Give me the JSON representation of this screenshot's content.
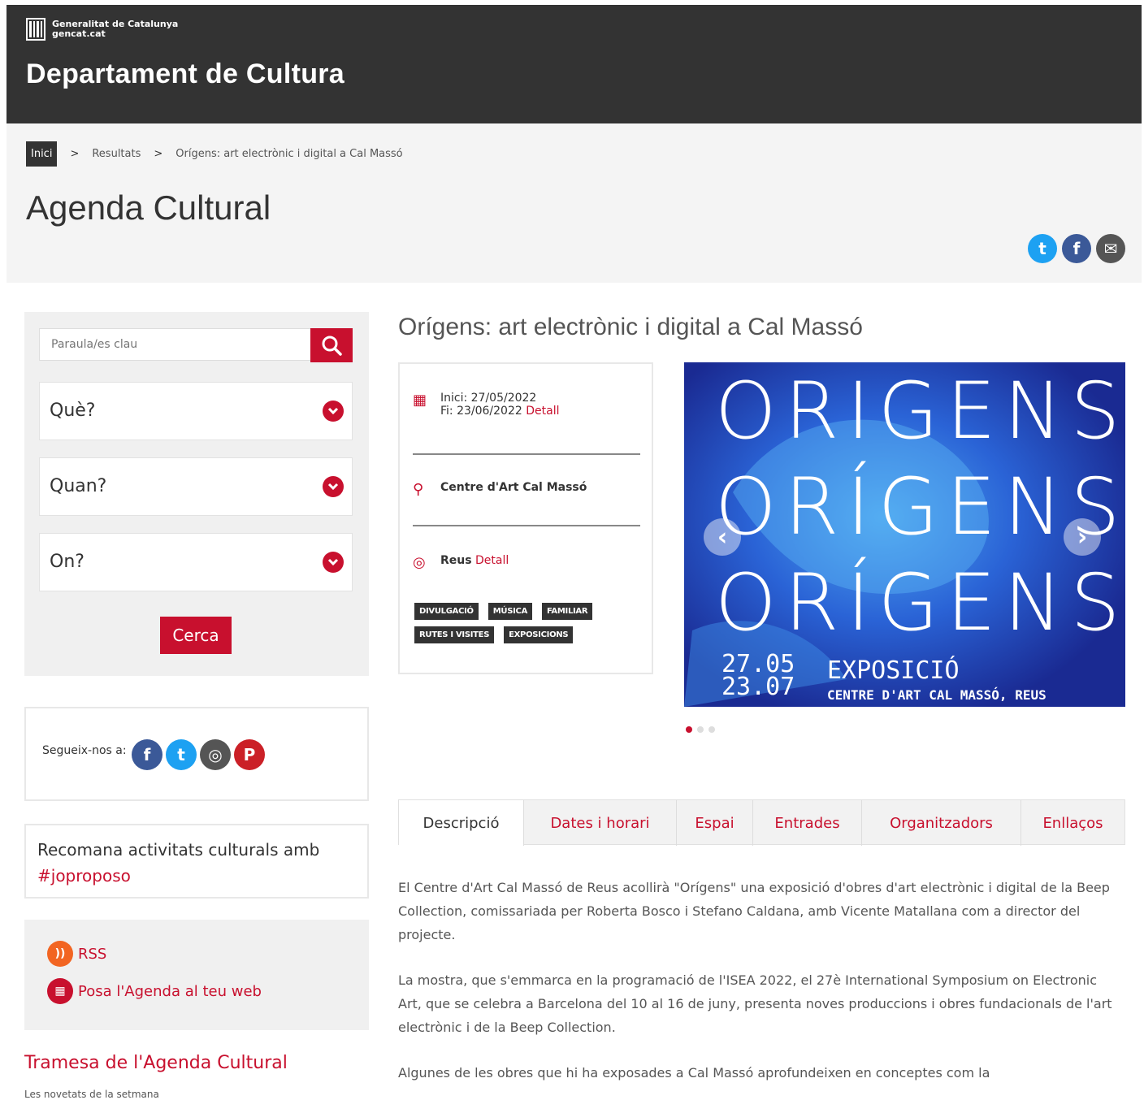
{
  "header": {
    "gov_line1": "Generalitat de Catalunya",
    "gov_line2": "gencat.cat",
    "department": "Departament de Cultura"
  },
  "breadcrumb": {
    "home": "Inici",
    "sep": ">",
    "results": "Resultats",
    "current": "Orígens: art electrònic i digital a Cal Massó"
  },
  "page_title": "Agenda Cultural",
  "share": [
    {
      "name": "twitter",
      "glyph": "t",
      "color": "#1da1f2"
    },
    {
      "name": "facebook",
      "glyph": "f",
      "color": "#3b5998"
    },
    {
      "name": "email",
      "glyph": "✉",
      "color": "#555555"
    }
  ],
  "search": {
    "placeholder": "Paraula/es clau",
    "filters": [
      "Què?",
      "Quan?",
      "On?"
    ],
    "button": "Cerca"
  },
  "follow": {
    "label": "Segueix-nos a:",
    "icons": [
      {
        "name": "facebook",
        "glyph": "f",
        "color": "#3b5998"
      },
      {
        "name": "twitter",
        "glyph": "t",
        "color": "#1da1f2"
      },
      {
        "name": "instagram",
        "glyph": "◎",
        "color": "#555555"
      },
      {
        "name": "pinterest",
        "glyph": "P",
        "color": "#cb2027"
      }
    ]
  },
  "recommend": {
    "text": "Recomana activitats culturals amb",
    "hashtag": "#joproposo"
  },
  "feeds": {
    "rss": "RSS",
    "embed": "Posa l'Agenda al teu web"
  },
  "newsletter": {
    "title": "Tramesa de l'Agenda Cultural",
    "subtitle": "Les novetats de la setmana"
  },
  "event": {
    "title": "Orígens: art electrònic i digital a Cal Massó",
    "start": "Inici: 27/05/2022",
    "end": "Fi: 23/06/2022",
    "detail": "Detall",
    "venue": "Centre d'Art Cal Massó",
    "city": "Reus",
    "tags": [
      "DIVULGACIÓ",
      "MÚSICA",
      "FAMILIAR",
      "RUTES I VISITES",
      "EXPOSICIONS"
    ]
  },
  "poster": {
    "line1": "ORIGENS",
    "line2": "ORÍGENS",
    "line3": "ORÍGENS",
    "date1": "27.05",
    "date2": "23.07",
    "expo": "EXPOSICIÓ",
    "centre": "CENTRE D'ART CAL MASSÓ, REUS"
  },
  "tabs": [
    "Descripció",
    "Dates i horari",
    "Espai",
    "Entrades",
    "Organitzadors",
    "Enllaços"
  ],
  "description": [
    "El Centre d'Art Cal Massó de Reus acollirà \"Orígens\" una exposició d'obres d'art electrònic i digital de la Beep Collection, comissariada per Roberta Bosco i Stefano Caldana, amb Vicente Matallana com a director del projecte.",
    "La mostra, que s'emmarca en la programació de l'ISEA 2022, el 27è International Symposium on Electronic Art, que se celebra a Barcelona del 10 al 16 de juny, presenta noves produccions i obres fundacionals de l'art electrònic i de la Beep Collection.",
    "Algunes de les obres que hi ha exposades a Cal Massó aprofundeixen en conceptes com la"
  ],
  "colors": {
    "accent": "#c8102e",
    "header_bg": "#333333"
  }
}
